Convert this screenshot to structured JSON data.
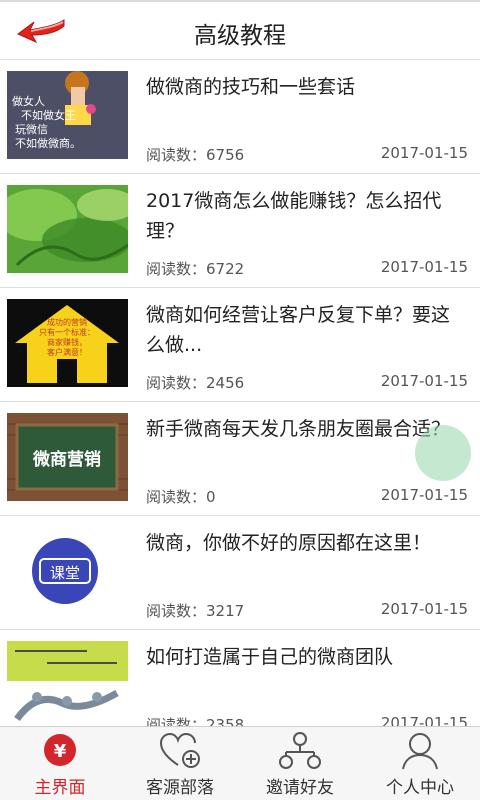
{
  "header": {
    "title": "高级教程"
  },
  "articles": [
    {
      "title": "做微商的技巧和一些套话",
      "reads_label": "阅读数：",
      "reads": "6756",
      "date": "2017-01-15",
      "thumb_text": [
        "做女人",
        "不如做女王",
        "玩微信",
        "不如做微商。"
      ]
    },
    {
      "title": "2017微商怎么做能赚钱？怎么招代理？",
      "reads_label": "阅读数：",
      "reads": "6722",
      "date": "2017-01-15"
    },
    {
      "title": "微商如何经营让客户反复下单？要这么做...",
      "reads_label": "阅读数：",
      "reads": "2456",
      "date": "2017-01-15",
      "thumb_text": [
        "成功的营销",
        "只有一个标准：",
        "商家赚钱，",
        "客户满意！"
      ]
    },
    {
      "title": "新手微商每天发几条朋友圈最合适？",
      "reads_label": "阅读数：",
      "reads": "0",
      "date": "2017-01-15",
      "thumb_text": [
        "微商营销"
      ]
    },
    {
      "title": "微商，你做不好的原因都在这里！",
      "reads_label": "阅读数：",
      "reads": "3217",
      "date": "2017-01-15",
      "thumb_text": [
        "课堂"
      ]
    },
    {
      "title": "如何打造属于自己的微商团队",
      "reads_label": "阅读数：",
      "reads": "2358",
      "date": "2017-01-15"
    }
  ],
  "tabs": [
    {
      "label": "主界面",
      "icon": "yen-icon",
      "active": true
    },
    {
      "label": "客源部落",
      "icon": "heart-plus-icon",
      "active": false
    },
    {
      "label": "邀请好友",
      "icon": "network-icon",
      "active": false
    },
    {
      "label": "个人中心",
      "icon": "person-icon",
      "active": false
    }
  ],
  "colors": {
    "accent": "#d3262c",
    "divider": "#dedede"
  }
}
